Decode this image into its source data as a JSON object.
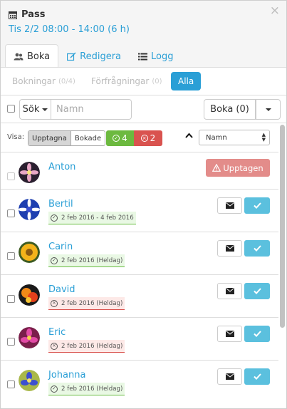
{
  "header": {
    "title": "Pass",
    "subtitle": "Tis 2/2 08:00 - 14:00 (6 h)",
    "close_glyph": "×"
  },
  "tabs": [
    {
      "label": "Boka",
      "icon": "users-icon",
      "active": true
    },
    {
      "label": "Redigera",
      "icon": "edit-icon",
      "active": false
    },
    {
      "label": "Logg",
      "icon": "list-icon",
      "active": false
    }
  ],
  "subtabs": [
    {
      "label": "Bokningar",
      "count": "(0/4)"
    },
    {
      "label": "Förfrågningar",
      "count": "(0)"
    },
    {
      "label": "Alla",
      "count": ""
    }
  ],
  "toolbar": {
    "search_label": "Sök",
    "name_placeholder": "Namn",
    "boka_label": "Boka (0)"
  },
  "filter": {
    "visa_label": "Visa:",
    "upptagna_label": "Upptagna",
    "bokade_label": "Bokade",
    "ok_count": "4",
    "bad_count": "2",
    "sort_value": "Namn"
  },
  "people": [
    {
      "name": "Anton",
      "status": "busy",
      "busy_label": "Upptagen",
      "date": ""
    },
    {
      "name": "Bertil",
      "status": "ok",
      "date": "2 feb 2016 - 4 feb 2016"
    },
    {
      "name": "Carin",
      "status": "ok",
      "date": "2 feb 2016 (Heldag)"
    },
    {
      "name": "David",
      "status": "bad",
      "date": "2 feb 2016 (Heldag)"
    },
    {
      "name": "Eric",
      "status": "bad",
      "date": "2 feb 2016 (Heldag)"
    },
    {
      "name": "Johanna",
      "status": "ok",
      "date": "2 feb 2016 (Heldag)"
    }
  ],
  "colors": {
    "accent": "#2a9fd6",
    "success": "#6cb93f",
    "danger": "#d9534f",
    "info": "#5bc0de",
    "busy": "#e38c8a"
  }
}
